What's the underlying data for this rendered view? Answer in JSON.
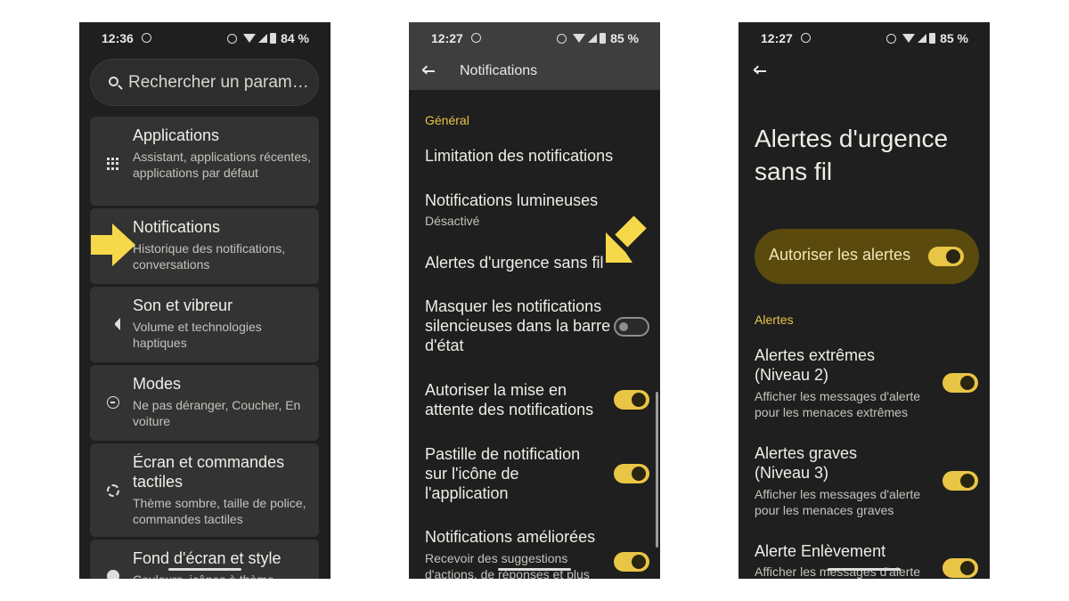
{
  "panel1": {
    "status": {
      "time": "12:36",
      "battery": "84 %"
    },
    "search": {
      "placeholder": "Rechercher un param…"
    },
    "items": [
      {
        "title": "Applications",
        "subtitle": "Assistant, applications récentes, applications par défaut",
        "icon": "apps-grid-icon"
      },
      {
        "title": "Notifications",
        "subtitle": "Historique des notifications, conversations",
        "icon": "bell-icon"
      },
      {
        "title": "Son et vibreur",
        "subtitle": "Volume et technologies haptiques",
        "icon": "speaker-icon"
      },
      {
        "title": "Modes",
        "subtitle": "Ne pas déranger, Coucher, En voiture",
        "icon": "minus-circle-icon"
      },
      {
        "title": "Écran et commandes tactiles",
        "subtitle": "Thème sombre, taille de police, commandes tactiles",
        "icon": "brightness-icon"
      },
      {
        "title": "Fond d'écran et style",
        "subtitle": "Couleurs, icônes à thème",
        "icon": "palette-icon"
      }
    ]
  },
  "panel2": {
    "status": {
      "time": "12:27",
      "battery": "85 %"
    },
    "title": "Notifications",
    "section": "Général",
    "items": [
      {
        "title": "Limitation des notifications"
      },
      {
        "title": "Notifications lumineuses",
        "subtitle": "Désactivé"
      },
      {
        "title": "Alertes d'urgence sans fil"
      },
      {
        "title": "Masquer les notifications silencieuses dans la barre d'état",
        "toggle": false
      },
      {
        "title": "Autoriser la mise en attente des notifications",
        "toggle": true
      },
      {
        "title": "Pastille de notification sur l'icône de l'application",
        "toggle": true
      },
      {
        "title": "Notifications améliorées",
        "subtitle": "Recevoir des suggestions d'actions, de réponses et plus",
        "toggle": true
      }
    ]
  },
  "panel3": {
    "status": {
      "time": "12:27",
      "battery": "85 %"
    },
    "title": "Alertes d'urgence sans fil",
    "master_label": "Autoriser les alertes",
    "master_on": true,
    "section": "Alertes",
    "items": [
      {
        "title": "Alertes extrêmes (Niveau 2)",
        "subtitle": "Afficher les messages d'alerte pour les menaces extrêmes",
        "toggle": true
      },
      {
        "title": "Alertes graves (Niveau 3)",
        "subtitle": "Afficher les messages d'alerte pour les menaces graves",
        "toggle": true
      },
      {
        "title": "Alerte Enlèvement",
        "subtitle": "Afficher les messages d'alerte",
        "toggle": true
      }
    ]
  },
  "colors": {
    "accent": "#e9c545",
    "arrow": "#f6d94a",
    "background": "#1f1f1f",
    "card": "#333333"
  }
}
